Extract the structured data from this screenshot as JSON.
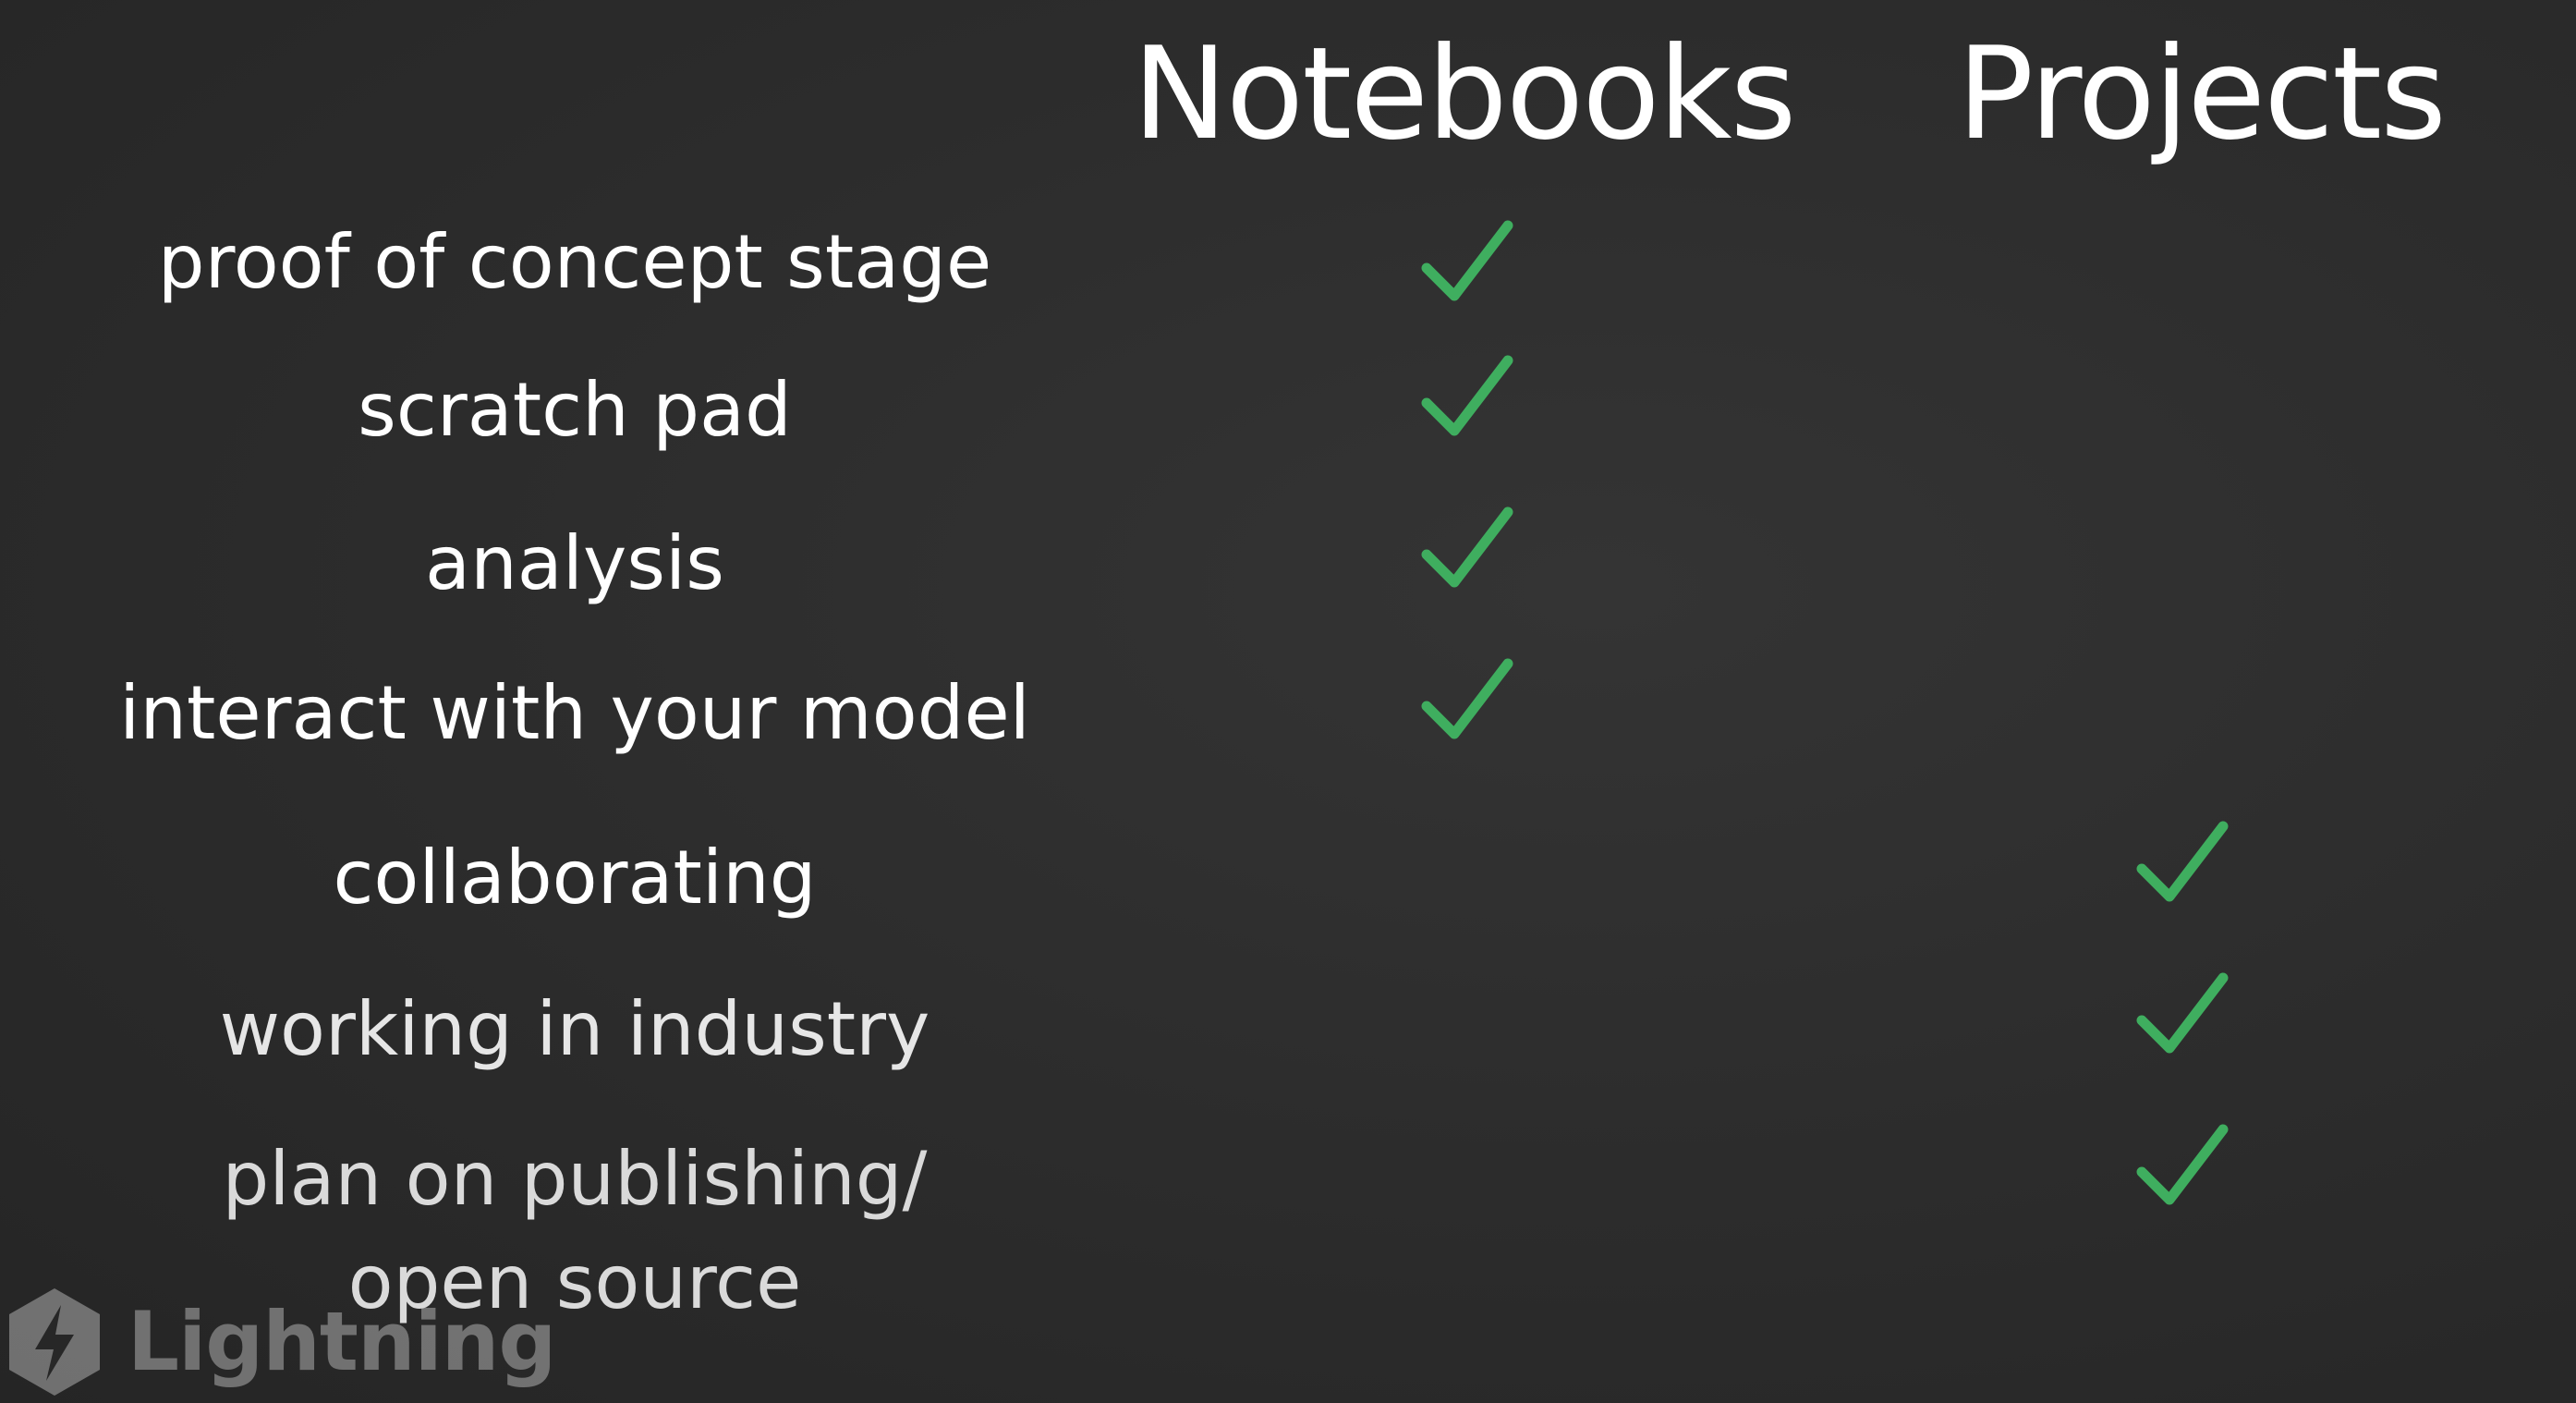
{
  "columns": {
    "notebooks": "Notebooks",
    "projects": "Projects"
  },
  "rows": [
    {
      "label": "proof of concept stage",
      "notebooks": true,
      "projects": false
    },
    {
      "label": "scratch pad",
      "notebooks": true,
      "projects": false
    },
    {
      "label": "analysis",
      "notebooks": true,
      "projects": false
    },
    {
      "label": "interact with your model",
      "notebooks": true,
      "projects": false
    },
    {
      "label": "collaborating",
      "notebooks": false,
      "projects": true
    },
    {
      "label": "working in industry",
      "notebooks": false,
      "projects": true
    },
    {
      "label_line1": "plan on publishing/",
      "label_line2": "open source",
      "notebooks": false,
      "projects": true
    }
  ],
  "logo": {
    "text": "Lightning",
    "icon": "lightning-bolt-hexagon-icon"
  },
  "colors": {
    "background": "#2d2d2d",
    "text": "#ffffff",
    "check": "#3fae5f"
  }
}
